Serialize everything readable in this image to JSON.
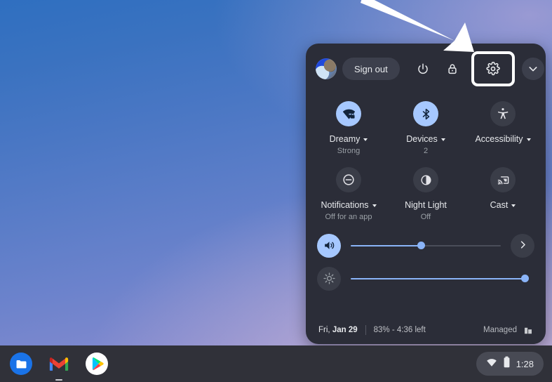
{
  "desktop": {
    "wallpaper_top_color": "#2f6fc0",
    "wallpaper_bottom_color": "#a497cf"
  },
  "annotation": {
    "arrow_name": "pointer-arrow",
    "arrow_color": "#ffffff",
    "highlight_color": "#ffffff",
    "highlight_target": "settings-button"
  },
  "quick_settings": {
    "header": {
      "avatar_label": "User avatar",
      "sign_out_label": "Sign out",
      "power_icon": "power-icon",
      "lock_icon": "lock-icon",
      "settings_icon": "gear-icon",
      "collapse_icon": "chevron-down-icon"
    },
    "tiles": [
      {
        "name": "network",
        "icon": "wifi-locked-icon",
        "label": "Dreamy",
        "sub": "Strong",
        "has_caret": true,
        "active": true
      },
      {
        "name": "bluetooth",
        "icon": "bluetooth-icon",
        "label": "Devices",
        "sub": "2",
        "has_caret": true,
        "active": true
      },
      {
        "name": "accessibility",
        "icon": "accessibility-icon",
        "label": "Accessibility",
        "sub": "",
        "has_caret": true,
        "active": false
      },
      {
        "name": "notifications",
        "icon": "do-not-disturb-icon",
        "label": "Notifications",
        "sub": "Off for an app",
        "has_caret": true,
        "active": false
      },
      {
        "name": "night-light",
        "icon": "night-light-icon",
        "label": "Night Light",
        "sub": "Off",
        "has_caret": false,
        "active": false
      },
      {
        "name": "cast",
        "icon": "cast-icon",
        "label": "Cast",
        "sub": "",
        "has_caret": true,
        "active": false
      }
    ],
    "sliders": [
      {
        "name": "volume",
        "icon": "volume-up-icon",
        "value": 47,
        "active": true,
        "has_next_button": true,
        "next_icon": "chevron-right-icon"
      },
      {
        "name": "brightness",
        "icon": "brightness-icon",
        "value": 100,
        "active": false,
        "has_next_button": false,
        "next_icon": ""
      }
    ],
    "footer": {
      "date_prefix": "Fri, ",
      "date_day": "Jan 29",
      "battery": "83% - 4:36 left",
      "managed_label": "Managed",
      "managed_icon": "enterprise-building-icon"
    },
    "accent_color": "#8ab4f8",
    "panel_color": "#2b2d38"
  },
  "shelf": {
    "apps": [
      {
        "name": "files",
        "label": "Files"
      },
      {
        "name": "gmail",
        "label": "Gmail"
      },
      {
        "name": "play-store",
        "label": "Play Store"
      }
    ],
    "tray": {
      "wifi_icon": "wifi-icon",
      "battery_icon": "battery-icon",
      "clock": "1:28"
    }
  }
}
